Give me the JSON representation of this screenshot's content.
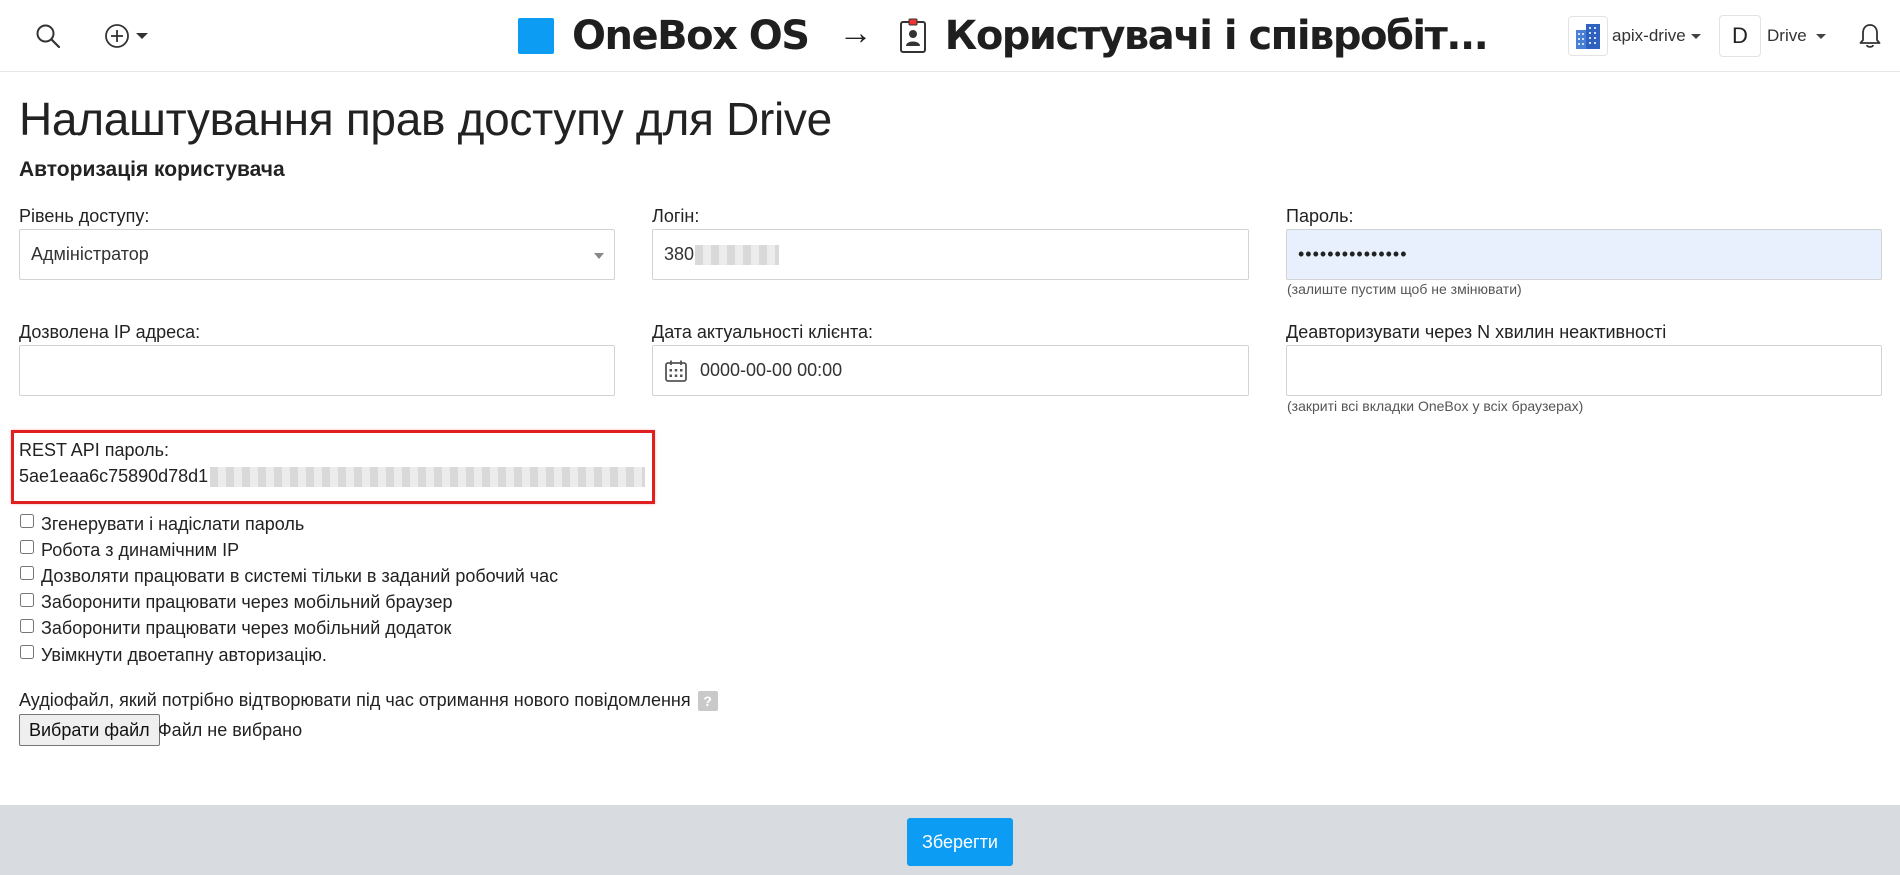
{
  "header": {
    "brand": "OneBox OS",
    "arrow": "→",
    "section_title": "Користувачі і співробіт...",
    "company_label": "apix-drive",
    "user_initial": "D",
    "user_label": "Drive",
    "accent_color": "#0d9cf3"
  },
  "page": {
    "title": "Налаштування прав доступу для Drive",
    "section": "Авторизація користувача"
  },
  "form": {
    "access_level": {
      "label": "Рівень доступу:",
      "value": "Адміністратор"
    },
    "login": {
      "label": "Логін:",
      "value": "380"
    },
    "password": {
      "label": "Пароль:",
      "value": "•••••••••••••••",
      "hint": "(залиште пустим щоб не змінювати)"
    },
    "allowed_ip": {
      "label": "Дозволена IP адреса:",
      "value": ""
    },
    "client_date": {
      "label": "Дата актуальності клієнта:",
      "value": "0000-00-00 00:00"
    },
    "deauth": {
      "label": "Деавторизувати через N хвилин неактивності",
      "value": "",
      "hint": "(закриті всі вкладки OneBox у всіх браузерах)"
    },
    "rest_api": {
      "label": "REST API пароль:",
      "value": "5ae1eaa6c75890d78d1"
    },
    "checkboxes": [
      {
        "label": "Згенерувати і надіслати пароль",
        "checked": false
      },
      {
        "label": "Робота з динамічним IP",
        "checked": false
      },
      {
        "label": "Дозволяти працювати в системі тільки в заданий робочий час",
        "checked": false
      },
      {
        "label": "Заборонити працювати через мобільний браузер",
        "checked": false
      },
      {
        "label": "Заборонити працювати через мобільний додаток",
        "checked": false
      },
      {
        "label": "Увімкнути двоетапну авторизацію.",
        "checked": false
      }
    ],
    "audio": {
      "label": "Аудіофайл, який потрібно відтворювати під час отримання нового повідомлення",
      "help": "?",
      "choose_label": "Вибрати файл",
      "status": "Файл не вибрано"
    }
  },
  "footer": {
    "save_label": "Зберегти"
  }
}
